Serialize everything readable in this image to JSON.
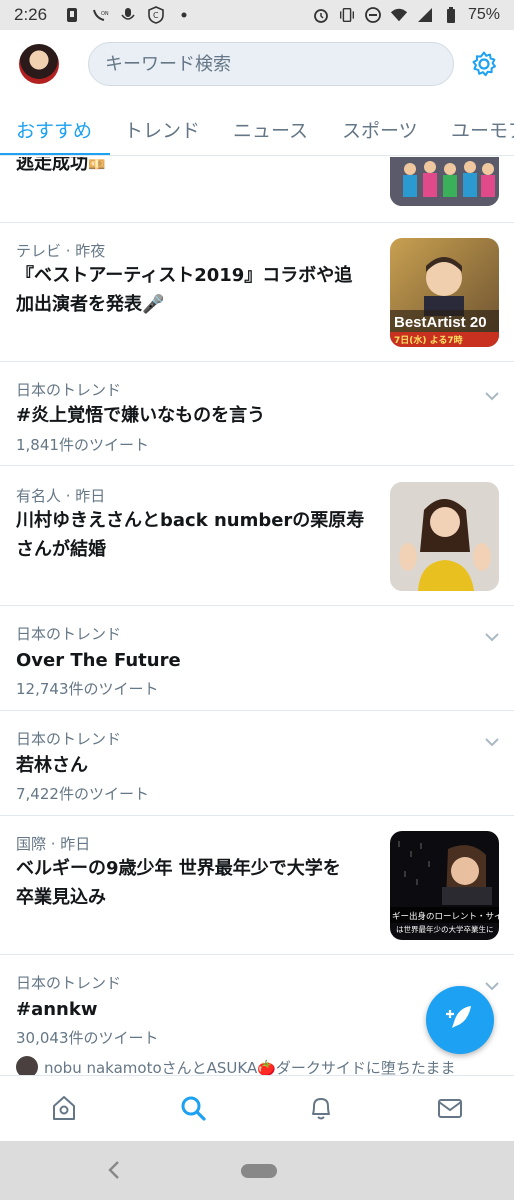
{
  "status_bar": {
    "time": "2:26",
    "battery": "75%"
  },
  "search": {
    "placeholder": "キーワード検索"
  },
  "tabs": [
    {
      "label": "おすすめ"
    },
    {
      "label": "トレンド"
    },
    {
      "label": "ニュース"
    },
    {
      "label": "スポーツ"
    },
    {
      "label": "ユーモア"
    }
  ],
  "feed": {
    "items": [
      {
        "title": "逃走成功",
        "emoji": "💴"
      },
      {
        "meta": "テレビ · 昨夜",
        "title_line1": "『ベストアーティスト2019』コラボや追",
        "title_line2": "加出演者を発表🎤"
      },
      {
        "meta": "日本のトレンド",
        "title": "#炎上覚悟で嫌いなものを言う",
        "count": "1,841件のツイート"
      },
      {
        "meta": "有名人 · 昨日",
        "title_line1": "川村ゆきえさんとback numberの栗原寿",
        "title_line2": "さんが結婚"
      },
      {
        "meta": "日本のトレンド",
        "title": "Over The Future",
        "count": "12,743件のツイート"
      },
      {
        "meta": "日本のトレンド",
        "title": "若林さん",
        "count": "7,422件のツイート"
      },
      {
        "meta": "国際 · 昨日",
        "title_line1": "ベルギーの9歳少年 世界最年少で大学を",
        "title_line2": "卒業見込み"
      },
      {
        "meta": "日本のトレンド",
        "title": "#annkw",
        "count": "30,043件のツイート",
        "footer": "nobu nakamotoさんとASUKA🍅ダークサイドに堕ちたまま"
      }
    ],
    "thumb_texts": {
      "bestartist": "BestArtist 20",
      "bestartist_sub": "7日(水) よる7時",
      "belgium": "ギー出身のローレント・サイモ",
      "belgium_sub": "は世界最年少の大学卒業生に"
    }
  }
}
